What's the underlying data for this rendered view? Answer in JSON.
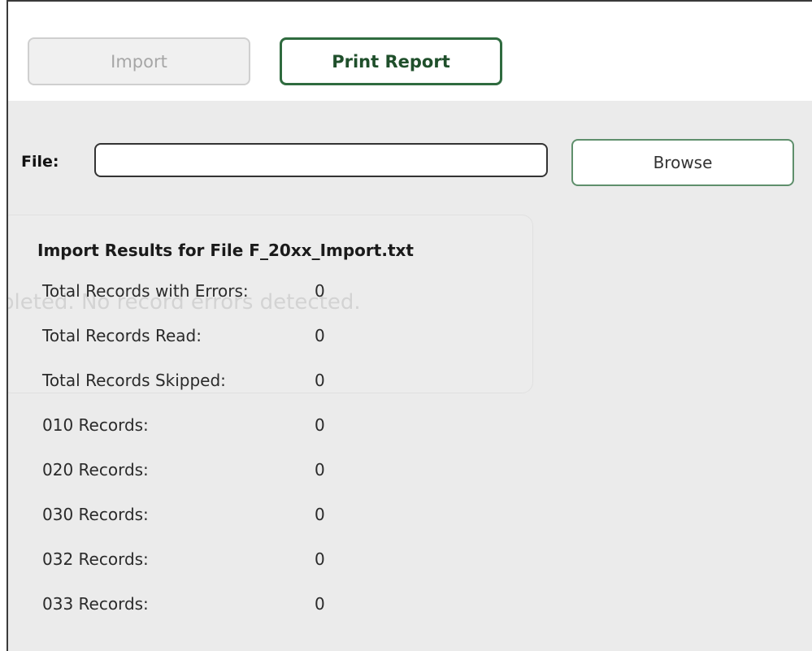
{
  "toolbar": {
    "import_label": "Import",
    "print_report_label": "Print Report"
  },
  "file": {
    "label": "File:",
    "value": "",
    "browse_label": "Browse"
  },
  "background_message": "pleted. No record errors detected.",
  "results": {
    "title": "Import Results for File F_20xx_Import.txt",
    "rows": [
      {
        "label": "Total Records with Errors:",
        "value": "0"
      },
      {
        "label": "Total Records Read:",
        "value": "0"
      },
      {
        "label": "Total Records Skipped:",
        "value": "0"
      },
      {
        "label": "010 Records:",
        "value": "0"
      },
      {
        "label": "020 Records:",
        "value": "0"
      },
      {
        "label": "030 Records:",
        "value": "0"
      },
      {
        "label": "032 Records:",
        "value": "0"
      },
      {
        "label": "033 Records:",
        "value": "0"
      }
    ]
  },
  "colors": {
    "print_button_border": "#2f6b3f",
    "browse_button_border": "#5f8f6c",
    "panel_background": "#ebebeb",
    "disabled_button_background": "#f0f0f0"
  }
}
